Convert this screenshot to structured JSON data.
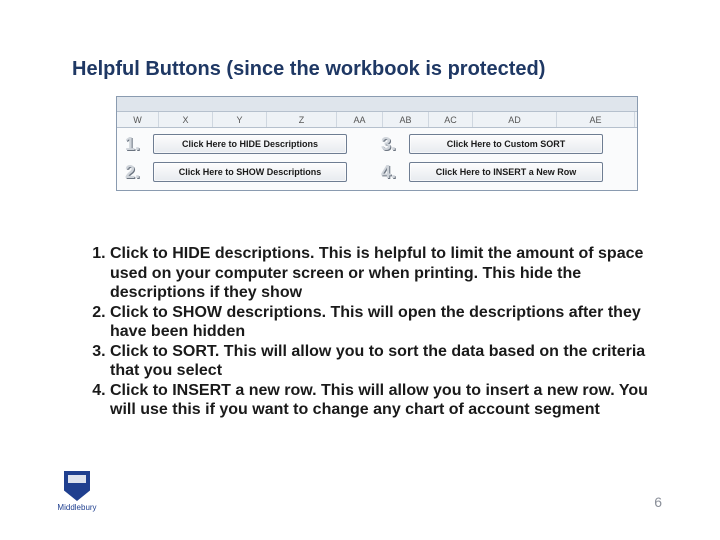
{
  "title": "Helpful Buttons (since the workbook is protected)",
  "columns": [
    "W",
    "X",
    "Y",
    "Z",
    "AA",
    "AB",
    "AC",
    "AD",
    "AE"
  ],
  "numbers": {
    "n1": "1.",
    "n2": "2.",
    "n3": "3.",
    "n4": "4."
  },
  "buttons": {
    "hide": "Click Here to HIDE Descriptions",
    "show": "Click Here to SHOW Descriptions",
    "sort": "Click Here to Custom SORT",
    "insert": "Click Here to INSERT a New Row"
  },
  "instructions": {
    "i1": "Click to HIDE descriptions.  This is helpful to limit the amount of space used on your computer screen or when printing.  This hide the descriptions if they show",
    "i2": "Click to SHOW descriptions.  This will open the descriptions after they have been hidden",
    "i3": "Click to SORT.  This will allow you to sort the data based on the criteria that you select",
    "i4": "Click to INSERT a new row.  This will allow you to insert a new row.  You will use this if you want to change any chart of account segment"
  },
  "logo_text": "Middlebury",
  "page_number": "6"
}
